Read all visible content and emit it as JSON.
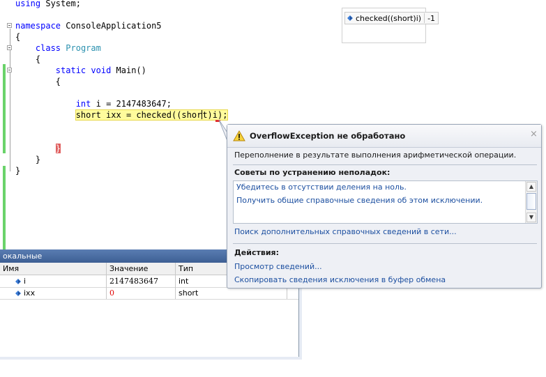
{
  "editor": {
    "lines": {
      "l1_kw": "using",
      "l1_rest": " System;",
      "ns_kw": "namespace",
      "ns_name": " ConsoleApplication5",
      "open1": "{",
      "class_kw": "class",
      "class_name": "Program",
      "open2": "{",
      "static_kw": "static",
      "void_kw": "void",
      "main_sig": " Main()",
      "open3": "{",
      "int_kw": "int",
      "int_rest": " i = 2147483647;",
      "short_part1": "short ixx = checked((shor",
      "short_part2": "t)i);",
      "close3": "}",
      "close2": "}",
      "close1": "}"
    }
  },
  "datatip": {
    "expression": "checked((short)i)",
    "value": "-1"
  },
  "locals": {
    "title": "окальные",
    "columns": [
      "Имя",
      "Значение",
      "Тип"
    ],
    "rows": [
      {
        "name": "i",
        "value": "2147483647",
        "type": "int"
      },
      {
        "name": "ixx",
        "value": "0",
        "type": "short"
      }
    ]
  },
  "exception": {
    "title": "OverflowException не обработано",
    "close": "×",
    "message": "Переполнение в результате выполнения арифметической операции.",
    "tips_heading": "Советы по устранению неполадок:",
    "tips": [
      "Убедитесь в отсутствии деления на ноль.",
      "Получить общие справочные сведения об этом исключении."
    ],
    "search_link": "Поиск дополнительных справочных сведений в сети...",
    "actions_heading": "Действия:",
    "actions": [
      "Просмотр сведений...",
      "Скопировать сведения исключения в буфер обмена"
    ]
  },
  "colors": {
    "keyword": "#0000ff",
    "type": "#2b91af",
    "highlight": "#fffb9c",
    "link": "#1c4fa0",
    "changed_margin": "#6ad36a"
  }
}
